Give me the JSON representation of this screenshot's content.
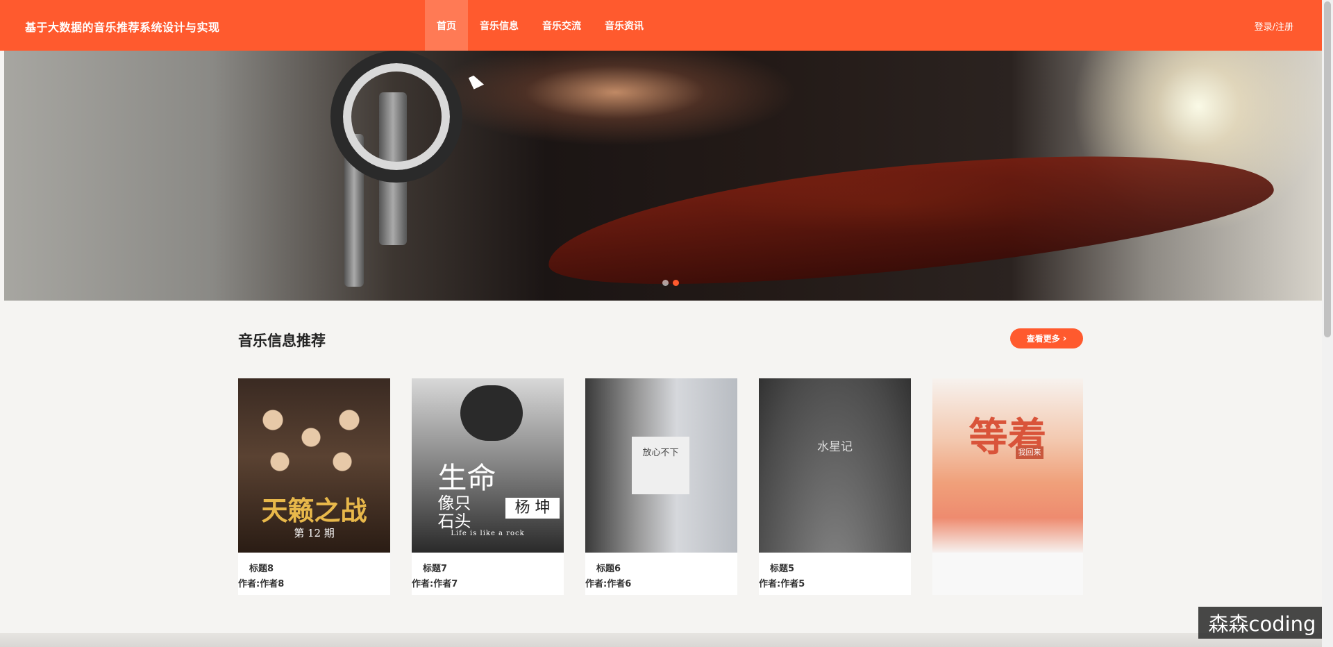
{
  "header": {
    "site_title": "基于大数据的音乐推荐系统设计与实现",
    "nav": [
      "首页",
      "音乐信息",
      "音乐交流",
      "音乐资讯"
    ],
    "active_nav": "首页",
    "login_label": "登录/注册",
    "accent_color": "#ff5a2e"
  },
  "banner": {
    "carousel_dots": 2,
    "active_dot": 2
  },
  "section": {
    "title": "音乐信息推荐",
    "more_label": "查看更多"
  },
  "cards": [
    {
      "title": "标题8",
      "author": "作者:作者8",
      "cover_text": [
        "天籁之战",
        "第 12 期"
      ]
    },
    {
      "title": "标题7",
      "author": "作者:作者7",
      "cover_text": [
        "生命",
        "像只",
        "石头",
        "杨 坤",
        "Life is like a rock"
      ]
    },
    {
      "title": "标题6",
      "author": "作者:作者6",
      "cover_text": [
        "放心不下"
      ]
    },
    {
      "title": "标题5",
      "author": "作者:作者5",
      "cover_text": [
        "水星记"
      ]
    },
    {
      "title": "",
      "author": "",
      "cover_text": [
        "等着",
        "我回来"
      ]
    }
  ],
  "watermark": "森森coding"
}
